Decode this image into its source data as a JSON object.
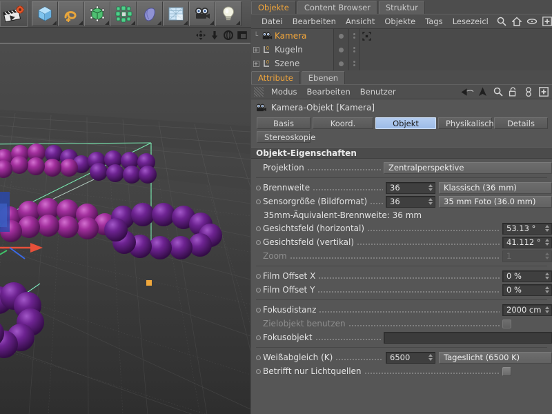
{
  "toolbar": {
    "record_icon": "clapperboard-record-icon",
    "tools": [
      {
        "name": "cube-primitive-icon",
        "label": "Würfel"
      },
      {
        "name": "spline-icon",
        "label": "Spline"
      },
      {
        "name": "deformer-icon",
        "label": "Deformer"
      },
      {
        "name": "mograph-icon",
        "label": "MoGraph"
      },
      {
        "name": "nurbs-icon",
        "label": "NURBS"
      },
      {
        "name": "environment-icon",
        "label": "Umgebung"
      },
      {
        "name": "camera-icon",
        "label": "Kamera"
      },
      {
        "name": "light-icon",
        "label": "Licht"
      }
    ]
  },
  "viewport": {
    "nav_icons": [
      "pan-icon",
      "dolly-icon",
      "rotate-icon",
      "maximize-icon"
    ]
  },
  "object_manager": {
    "tabs": [
      {
        "label": "Objekte",
        "active": true
      },
      {
        "label": "Content Browser",
        "active": false
      },
      {
        "label": "Struktur",
        "active": false
      }
    ],
    "menus": [
      "Datei",
      "Bearbeiten",
      "Ansicht",
      "Objekte",
      "Tags",
      "Lesezeicl"
    ],
    "menu_icons": [
      "search-icon",
      "home-icon",
      "eye-icon",
      "plus-box-icon"
    ],
    "rows": [
      {
        "label": "Kamera",
        "selected": true,
        "expandable": false,
        "icon": "camera-object-icon",
        "tag": "camera-tag-icon"
      },
      {
        "label": "Kugeln",
        "selected": false,
        "expandable": true,
        "icon": "null-object-icon",
        "tag": ""
      },
      {
        "label": "Szene",
        "selected": false,
        "expandable": true,
        "icon": "null-object-icon",
        "tag": ""
      }
    ]
  },
  "attribute_manager": {
    "tabs": [
      {
        "label": "Attribute",
        "active": true
      },
      {
        "label": "Ebenen",
        "active": false
      }
    ],
    "menus": [
      "Modus",
      "Bearbeiten",
      "Benutzer"
    ],
    "menu_icons": [
      "back-arrow-icon",
      "forward-arrow-icon",
      "up-arrow-icon",
      "search-icon",
      "lock-icon",
      "link-icon",
      "plus-box-icon"
    ],
    "object_icon": "camera-object-icon",
    "object_title": "Kamera-Objekt [Kamera]",
    "type_tabs_row1": [
      {
        "label": "Basis",
        "active": false
      },
      {
        "label": "Koord.",
        "active": false
      },
      {
        "label": "Objekt",
        "active": true
      },
      {
        "label": "Physikalisch",
        "active": false
      },
      {
        "label": "Details",
        "active": false
      }
    ],
    "type_tabs_row2": [
      {
        "label": "Stereoskopie",
        "active": false
      }
    ],
    "section_title": "Objekt-Eigenschaften",
    "properties": {
      "projektion": {
        "label": "Projektion",
        "value": "Zentralperspektive"
      },
      "brennweite": {
        "label": "Brennweite",
        "value": "36",
        "preset": "Klassisch (36 mm)"
      },
      "sensorgroesse": {
        "label": "Sensorgröße (Bildformat)",
        "value": "36",
        "preset": "35 mm Foto (36.0 mm)"
      },
      "aequivalent": {
        "label": "35mm-Äquivalent-Brennweite: 36 mm"
      },
      "fov_h": {
        "label": "Gesichtsfeld (horizontal)",
        "value": "53.13 °"
      },
      "fov_v": {
        "label": "Gesichtsfeld (vertikal)",
        "value": "41.112 °"
      },
      "zoom": {
        "label": "Zoom",
        "value": "1"
      },
      "film_offset_x": {
        "label": "Film Offset X",
        "value": "0 %"
      },
      "film_offset_y": {
        "label": "Film Offset Y",
        "value": "0 %"
      },
      "fokusdistanz": {
        "label": "Fokusdistanz",
        "value": "2000 cm"
      },
      "zielobjekt": {
        "label": "Zielobjekt benutzen",
        "checked": false
      },
      "fokusobjekt": {
        "label": "Fokusobjekt",
        "value": ""
      },
      "weissabgleich": {
        "label": "Weißabgleich (K)",
        "value": "6500",
        "preset": "Tageslicht (6500 K)"
      },
      "nur_lichtquellen": {
        "label": "Betrifft nur Lichtquellen",
        "checked": false
      }
    }
  },
  "colors": {
    "accent": "#f2a63b",
    "active_tab": "#a9c4ec",
    "sphere": "#7b2a7e",
    "gizmo_x": "#e8503a",
    "camera_frustum": "#7fe8b4",
    "panel_bg": "#565656"
  },
  "scene": {
    "description": "3D Viewport mit Kugel-Ringen, Kamera-Frustum und Achsen-Gizmo"
  }
}
